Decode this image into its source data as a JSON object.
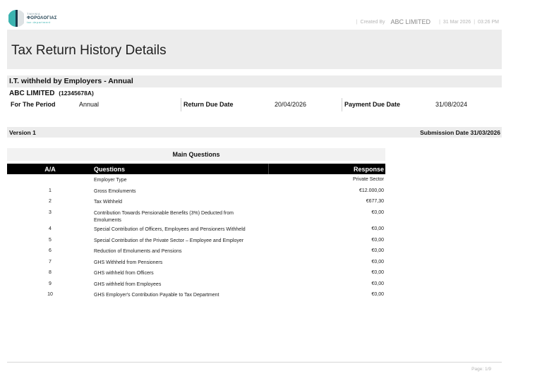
{
  "logo": {
    "line1": "ΤΜΗΜΑ",
    "line2": "ΦΟΡΟΛΟΓΙΑΣ",
    "line3": "tax department",
    "accent": "#3bb3b0",
    "dark": "#1a3b4c"
  },
  "header": {
    "created_by_label": "Created By",
    "company": "ABC LIMITED",
    "date": "31 Mar 2026",
    "time": "03:26 PM"
  },
  "title": "Tax Return History Details",
  "section": {
    "title": "I.T. withheld by Employers - Annual",
    "company_name": "ABC LIMITED",
    "tin": "(12345678A)"
  },
  "period": {
    "period_label": "For The Period",
    "period_value": "Annual",
    "return_due_label": "Return Due Date",
    "return_due_value": "20/04/2026",
    "payment_due_label": "Payment Due Date",
    "payment_due_value": "31/08/2024"
  },
  "version": {
    "label": "Version 1",
    "submission": "Submission Date 31/03/2026"
  },
  "questions": {
    "heading": "Main Questions",
    "columns": [
      "A/A",
      "Questions",
      "Response"
    ],
    "rows": [
      {
        "aa": "",
        "question": "Employer Type",
        "response": "Private Sector"
      },
      {
        "aa": "1",
        "question": "Gross Emoluments",
        "response": "€12.000,00"
      },
      {
        "aa": "2",
        "question": "Tax Withheld",
        "response": "€677,30"
      },
      {
        "aa": "3",
        "question": "Contribution Towards Pensionable Benefits (3%) Deducted from Emoluments",
        "response": "€0,00"
      },
      {
        "aa": "4",
        "question": "Special Contribution of Officers, Employees and Pensioners Withheld",
        "response": "€0,00"
      },
      {
        "aa": "5",
        "question": "Special Contribution of the Private Sector – Employee and Employer",
        "response": "€0,00"
      },
      {
        "aa": "6",
        "question": "Reduction of Emoluments and Pensions",
        "response": "€0,00"
      },
      {
        "aa": "7",
        "question": "GHS Withheld from Pensioners",
        "response": "€0,00"
      },
      {
        "aa": "8",
        "question": "GHS withheld from Officers",
        "response": "€0,00"
      },
      {
        "aa": "9",
        "question": "GHS withheld from Employees",
        "response": "€0,00"
      },
      {
        "aa": "10",
        "question": "GHS Employer's Contribution Payable to Tax Department",
        "response": "€0,00"
      }
    ]
  },
  "footer": {
    "page": "Page: 1/9"
  }
}
